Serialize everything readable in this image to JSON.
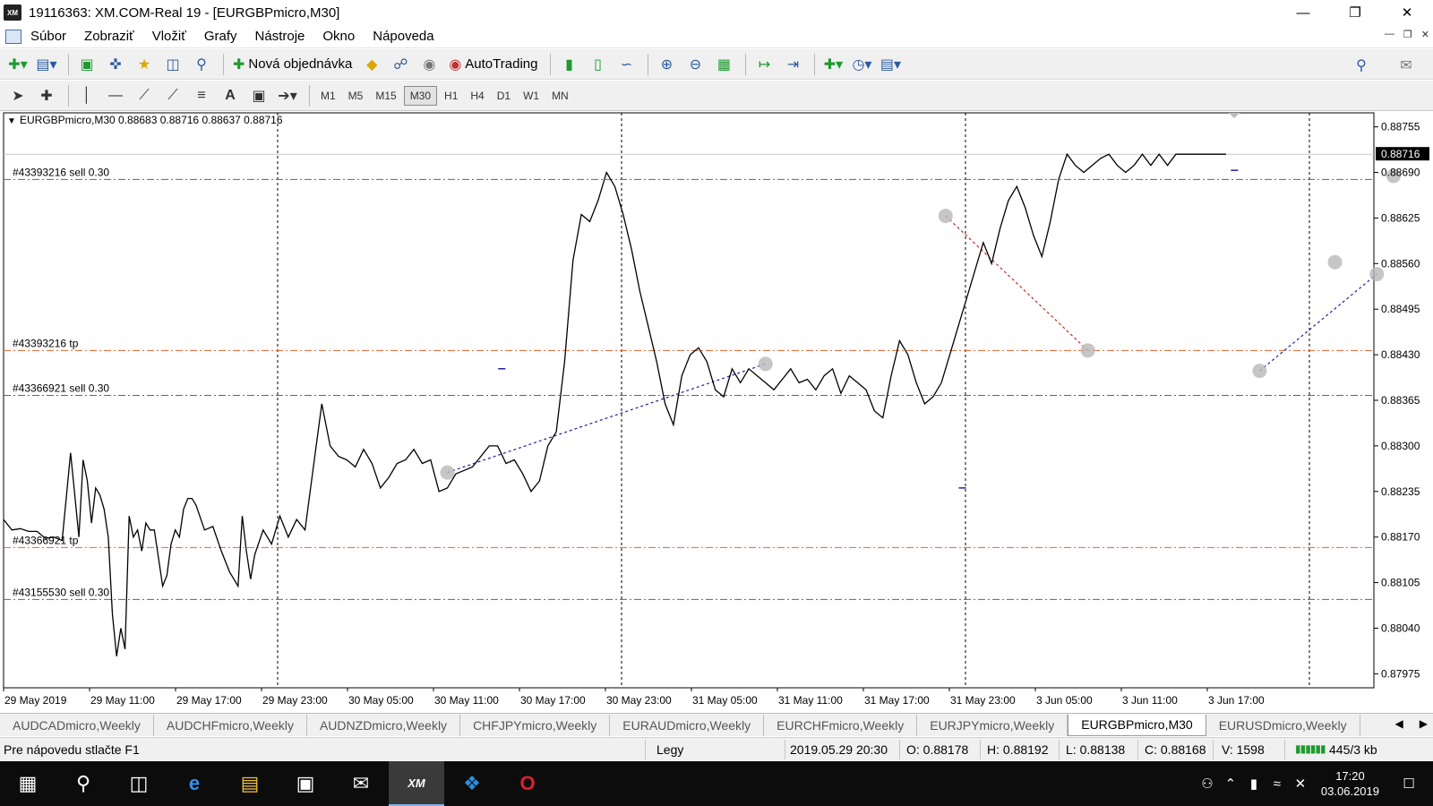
{
  "window": {
    "title": "19116363: XM.COM-Real 19 - [EURGBPmicro,M30]",
    "app_icon_text": "XM"
  },
  "menu": [
    "Súbor",
    "Zobraziť",
    "Vložiť",
    "Grafy",
    "Nástroje",
    "Okno",
    "Nápoveda"
  ],
  "toolbar": {
    "new_order": "Nová objednávka",
    "autotrading": "AutoTrading"
  },
  "timeframes": [
    "M1",
    "M5",
    "M15",
    "M30",
    "H1",
    "H4",
    "D1",
    "W1",
    "MN"
  ],
  "active_timeframe": "M30",
  "chart": {
    "header": "EURGBPmicro,M30  0.88683 0.88716 0.88637 0.88716",
    "current_price": "0.88716",
    "price_ticks": [
      "0.88755",
      "0.88690",
      "0.88625",
      "0.88560",
      "0.88495",
      "0.88430",
      "0.88365",
      "0.88300",
      "0.88235",
      "0.88170",
      "0.88105",
      "0.88040",
      "0.87975"
    ],
    "time_ticks": [
      "29 May 2019",
      "29 May 11:00",
      "29 May 17:00",
      "29 May 23:00",
      "30 May 05:00",
      "30 May 11:00",
      "30 May 17:00",
      "30 May 23:00",
      "31 May 05:00",
      "31 May 11:00",
      "31 May 17:00",
      "31 May 23:00",
      "3 Jun 05:00",
      "3 Jun 11:00",
      "3 Jun 17:00"
    ],
    "order_lines": [
      {
        "label": "#43393216 sell 0.30",
        "price": 0.8868,
        "color": "#2e8b2e"
      },
      {
        "label": "#43393216 tp",
        "price": 0.88436,
        "color": "#e8632c"
      },
      {
        "label": "#43366921 sell 0.30",
        "price": 0.88372,
        "color": "#2e8b2e"
      },
      {
        "label": "#43366921 tp",
        "price": 0.88155,
        "color": "#e8632c"
      },
      {
        "label": "#43155530 sell 0.30",
        "price": 0.88081,
        "color": "#2e8b2e"
      }
    ]
  },
  "chart_data": {
    "type": "line",
    "symbol": "EURGBPmicro",
    "timeframe": "M30",
    "ylim": [
      0.87955,
      0.88775
    ],
    "x": [
      0,
      2,
      4,
      6,
      8,
      10,
      12,
      14,
      16,
      17,
      18,
      19,
      20,
      21,
      22,
      23,
      24,
      25,
      26,
      27,
      28,
      29,
      30,
      31,
      32,
      33,
      34,
      35,
      36,
      37,
      38,
      39,
      40,
      41,
      42,
      43,
      44,
      45,
      46,
      48,
      50,
      52,
      54,
      55,
      56,
      57,
      58,
      59,
      60,
      62,
      64,
      66,
      68,
      70,
      72,
      74,
      76,
      78,
      80,
      82,
      84,
      86,
      88,
      90,
      92,
      94,
      96,
      98,
      100,
      102,
      104,
      106,
      108,
      110,
      112,
      114,
      116,
      118,
      120,
      122,
      124,
      126,
      128,
      130,
      132,
      134,
      136,
      138,
      140,
      142,
      144,
      146,
      148,
      150,
      152,
      154,
      156,
      158,
      160,
      162,
      164,
      166,
      168,
      170,
      172,
      174,
      176,
      178,
      180,
      182,
      184,
      186,
      188,
      190,
      192,
      194,
      196,
      198,
      200,
      202,
      204,
      206,
      208,
      210,
      212,
      214,
      216,
      218,
      220,
      222,
      224,
      226,
      228,
      230,
      232,
      234,
      236,
      238,
      240,
      242,
      244,
      246,
      248,
      250,
      252,
      254,
      256,
      258,
      260,
      262,
      264,
      266,
      268,
      270,
      272,
      274,
      276,
      278,
      280,
      282,
      284,
      286,
      288,
      290,
      292
    ],
    "values": [
      0.88195,
      0.8818,
      0.88182,
      0.88178,
      0.88178,
      0.88168,
      0.8817,
      0.88165,
      0.8829,
      0.8823,
      0.8817,
      0.8828,
      0.8825,
      0.8819,
      0.8824,
      0.8823,
      0.8821,
      0.8817,
      0.8806,
      0.88,
      0.8804,
      0.8801,
      0.882,
      0.8817,
      0.8818,
      0.8815,
      0.8819,
      0.8818,
      0.8818,
      0.8814,
      0.881,
      0.88115,
      0.8816,
      0.8818,
      0.8817,
      0.8821,
      0.88225,
      0.88225,
      0.88215,
      0.8818,
      0.88185,
      0.8815,
      0.8812,
      0.8811,
      0.881,
      0.882,
      0.8815,
      0.8811,
      0.88145,
      0.8818,
      0.8816,
      0.882,
      0.8817,
      0.88195,
      0.8818,
      0.8827,
      0.8836,
      0.883,
      0.88285,
      0.8828,
      0.8827,
      0.88295,
      0.88275,
      0.8824,
      0.88255,
      0.88275,
      0.8828,
      0.88295,
      0.88275,
      0.8828,
      0.88235,
      0.8824,
      0.8826,
      0.88265,
      0.8827,
      0.88285,
      0.883,
      0.883,
      0.88275,
      0.8828,
      0.8826,
      0.88235,
      0.8825,
      0.883,
      0.8832,
      0.8842,
      0.88565,
      0.8863,
      0.8862,
      0.8865,
      0.8869,
      0.8867,
      0.8863,
      0.8858,
      0.8852,
      0.8847,
      0.8842,
      0.8836,
      0.8833,
      0.884,
      0.8843,
      0.8844,
      0.8842,
      0.8838,
      0.8837,
      0.8841,
      0.8839,
      0.8841,
      0.884,
      0.8839,
      0.8838,
      0.88395,
      0.8841,
      0.8839,
      0.88395,
      0.8838,
      0.884,
      0.8841,
      0.88375,
      0.884,
      0.8839,
      0.8838,
      0.8835,
      0.8834,
      0.884,
      0.8845,
      0.8843,
      0.8839,
      0.8836,
      0.8837,
      0.8839,
      0.8843,
      0.8847,
      0.8851,
      0.8855,
      0.8859,
      0.8856,
      0.8861,
      0.8865,
      0.8867,
      0.8864,
      0.886,
      0.8857,
      0.8862,
      0.8868,
      0.88716,
      0.887,
      0.8869,
      0.887,
      0.8871,
      0.88716,
      0.887,
      0.8869,
      0.887,
      0.88716,
      0.887,
      0.88716,
      0.887,
      0.88716,
      0.88716,
      0.88716,
      0.88716,
      0.88716,
      0.88716,
      0.88716,
      0.88716,
      0.88716,
      0.88716,
      0.88716,
      0.88716
    ],
    "grid": false
  },
  "tabs": [
    "AUDCADmicro,Weekly",
    "AUDCHFmicro,Weekly",
    "AUDNZDmicro,Weekly",
    "CHFJPYmicro,Weekly",
    "EURAUDmicro,Weekly",
    "EURCHFmicro,Weekly",
    "EURJPYmicro,Weekly",
    "EURGBPmicro,M30",
    "EURUSDmicro,Weekly"
  ],
  "active_tab": "EURGBPmicro,M30",
  "status": {
    "help": "Pre nápovedu stlačte F1",
    "profile": "Legy",
    "datetime": "2019.05.29 20:30",
    "open": "O: 0.88178",
    "high": "H: 0.88192",
    "low": "L: 0.88138",
    "close": "C: 0.88168",
    "volume": "V: 1598",
    "traffic": "445/3 kb"
  },
  "taskbar": {
    "time": "17:20",
    "date": "03.06.2019"
  }
}
